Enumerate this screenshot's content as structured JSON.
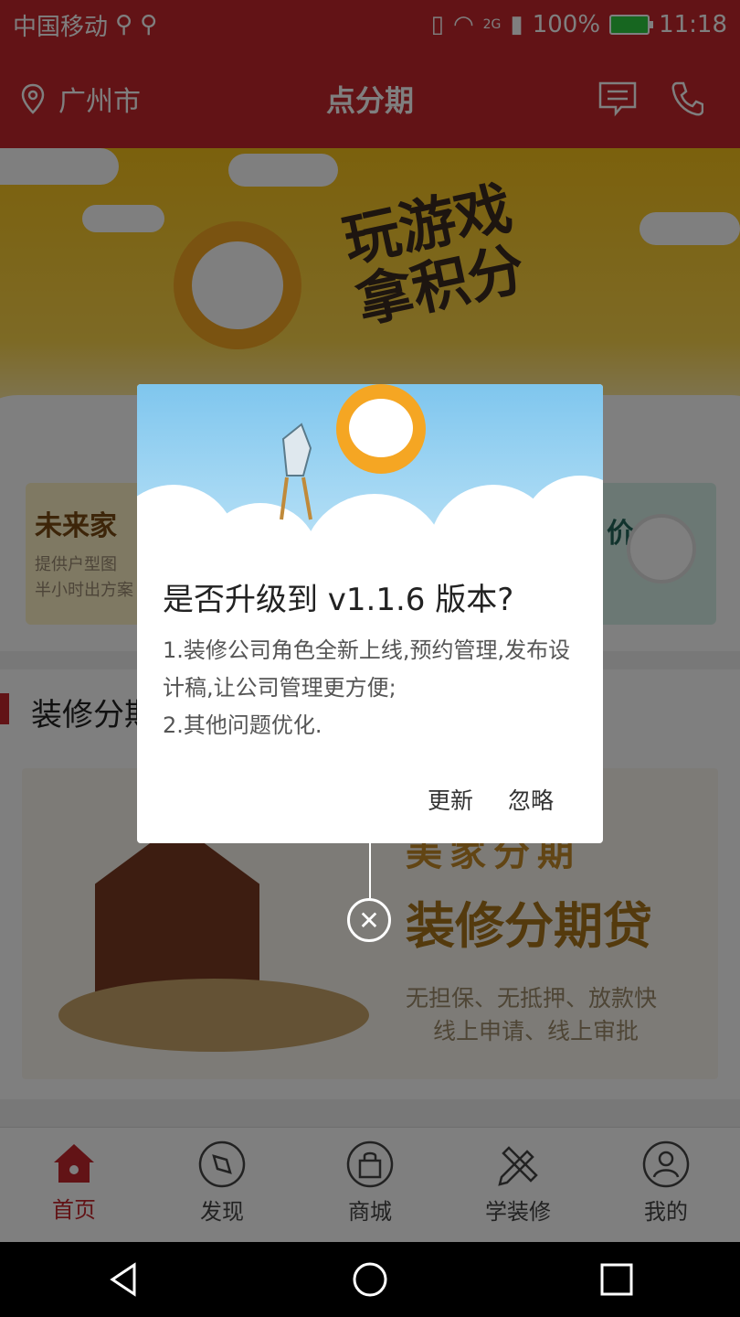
{
  "status_bar": {
    "carrier": "中国移动",
    "network": "2G",
    "battery": "100%",
    "time": "11:18"
  },
  "app_bar": {
    "city": "广州市",
    "title": "点分期"
  },
  "banner": {
    "headline_line1": "玩游戏",
    "headline_line2": "拿积分"
  },
  "cards": {
    "left_title": "未来家",
    "left_line1": "提供户型图",
    "left_line2": "半小时出方案",
    "right_title_partial": "价"
  },
  "section": {
    "title": "装修分期",
    "promo_brand": "美家分期",
    "promo_title": "装修分期贷",
    "promo_line1": "无担保、无抵押、放款快",
    "promo_line2": "线上申请、线上审批"
  },
  "tabs": [
    {
      "label": "首页",
      "icon": "home-icon",
      "active": true
    },
    {
      "label": "发现",
      "icon": "compass-icon",
      "active": false
    },
    {
      "label": "商城",
      "icon": "shopping-bag-icon",
      "active": false
    },
    {
      "label": "学装修",
      "icon": "pencil-ruler-icon",
      "active": false
    },
    {
      "label": "我的",
      "icon": "user-icon",
      "active": false
    }
  ],
  "dialog": {
    "title": "是否升级到 v1.1.6 版本?",
    "body_line1": "1.装修公司角色全新上线,预约管理,发布设计稿,让公司管理更方便;",
    "body_line2": "2.其他问题优化.",
    "update_label": "更新",
    "ignore_label": "忽略"
  },
  "colors": {
    "brand_red": "#c4262c",
    "banner_yellow": "#f7c21a",
    "dialog_sky": "#7fc6ee"
  }
}
